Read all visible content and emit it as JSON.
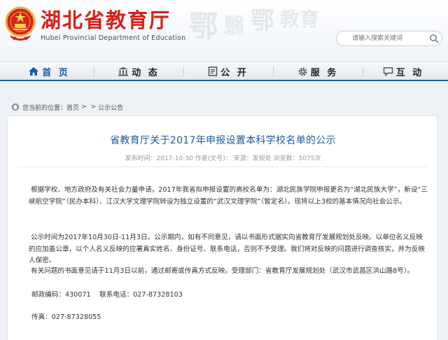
{
  "header": {
    "title": "湖北省教育厅",
    "subtitle": "Hubei Provincial Department of Education",
    "search_placeholder": "请输入搜索关键词",
    "watermarks": [
      "鄂",
      "翳",
      "鄂",
      "教育"
    ]
  },
  "nav": {
    "items": [
      {
        "label": "首 页",
        "icon": "home-icon"
      },
      {
        "label": "动 态",
        "icon": "building-icon"
      },
      {
        "label": "公 开",
        "icon": "document-icon"
      },
      {
        "label": "服 务",
        "icon": "gear-icon"
      },
      {
        "label": "互 动",
        "icon": "chat-icon"
      }
    ]
  },
  "breadcrumb": {
    "prefix": "您当前的位置：",
    "home": "首页",
    "separator": ">",
    "separator2": ">",
    "current": "公示公告"
  },
  "article": {
    "title": "省教育厅关于2017年申报设置本科学校名单的公示",
    "meta": "发布时间：2017-10-30 作者(文号)： 来源：发规处 浏览数：5075次",
    "paragraphs": [
      "根据学校、地方政府及有关社会力量申请，2017年我省拟申报设置的高校名单为：湖北民族学院申报更名为“湖北民族大学”，新设“三峡航空学院”（民办本科）、江汉大学文理学院转设为独立设置的“武汉文理学院”（暂定名）。现将以上3校的基本情况向社会公示。",
      "公示时间为2017年10月30日-11月3日。公示期内，如有不同意见，请以书面形式据实向省教育厅发展规划处反映。以单位名义反映的应加盖公章，以个人名义反映的应署真实姓名、身份证号、联系电话，否则不予受理。我们将对反映的问题进行调查核实，并为反映人保密。",
      "有关问题的书面意见请于11月3日以前，通过邮寄或传真方式反映。受理部门：省教育厅发展规划处（武汉市武昌区洪山路8号）。"
    ],
    "contact_line": "邮政编码：430071　  联系电话：027-87328103",
    "fax_line": "传真：027-87328055"
  },
  "colors": {
    "brand_red": "#d8201a",
    "nav_blue": "#1e5aa0"
  }
}
